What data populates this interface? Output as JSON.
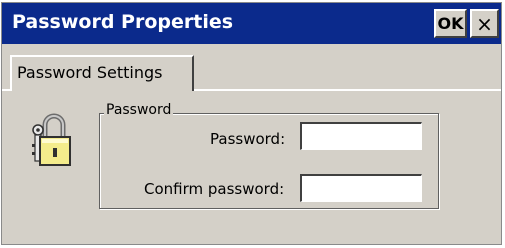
{
  "window": {
    "title": "Password Properties",
    "ok_label": "OK",
    "close_glyph": "×"
  },
  "tabs": [
    {
      "label": "Password Settings",
      "selected": true
    }
  ],
  "password_group": {
    "legend": "Password",
    "password_label": "Password:",
    "password_value": "",
    "confirm_label": "Confirm password:",
    "confirm_value": ""
  },
  "icons": {
    "lock": "padlock-keys-icon"
  },
  "colors": {
    "titlebar": "#0b2a8c",
    "face": "#d4d0c8"
  }
}
